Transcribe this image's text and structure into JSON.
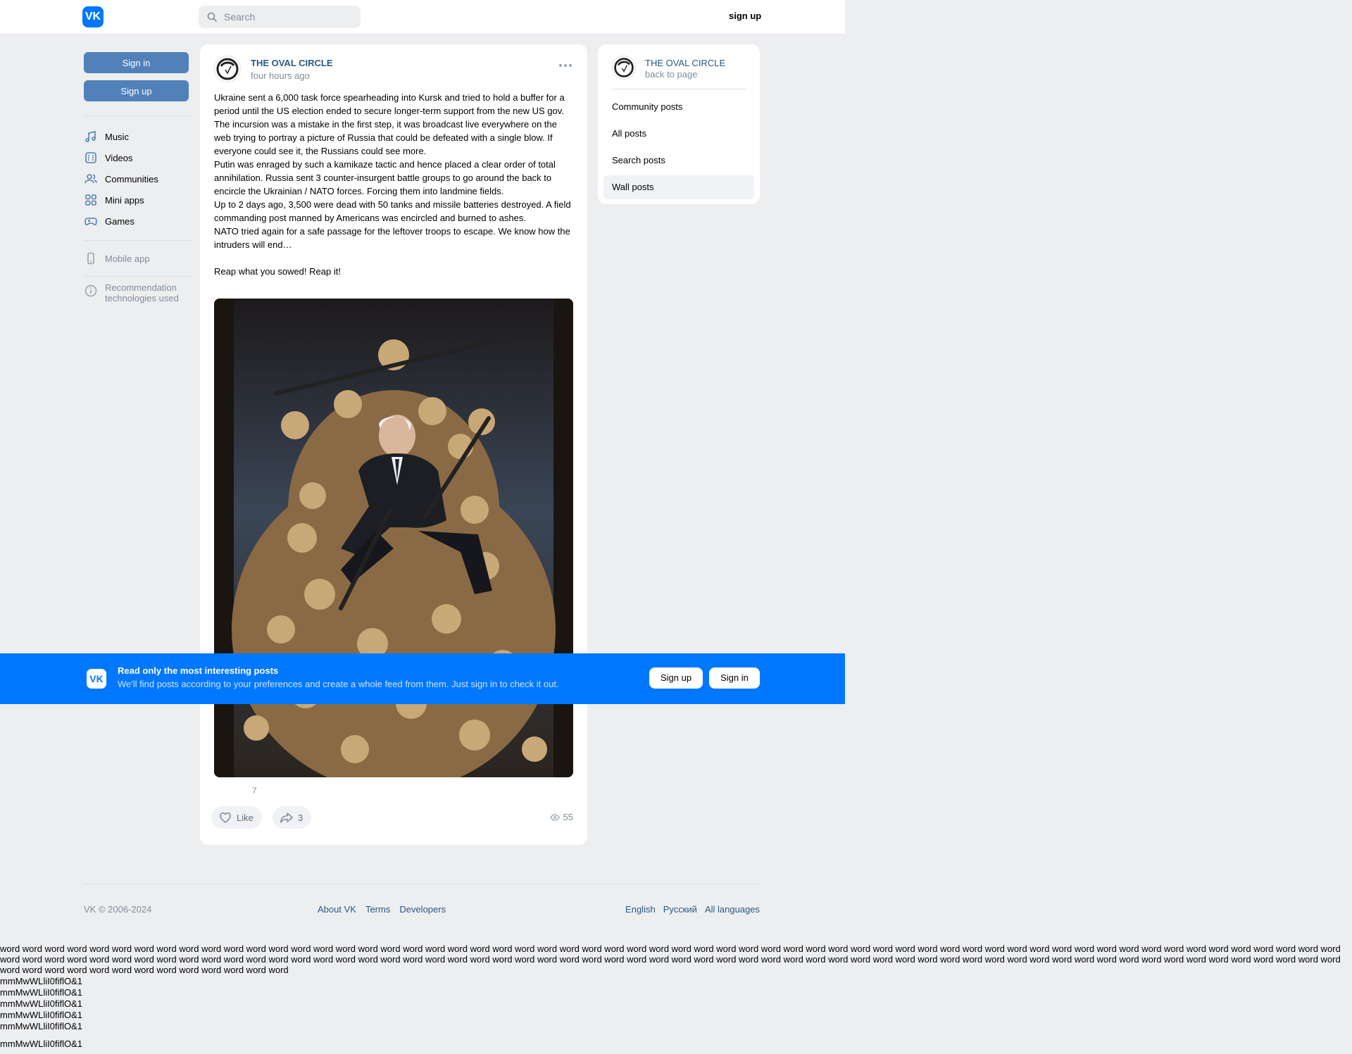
{
  "header": {
    "search_placeholder": "Search",
    "signup_label": "sign up"
  },
  "left": {
    "signin_label": "Sign in",
    "signup_label": "Sign up",
    "nav": {
      "music": "Music",
      "videos": "Videos",
      "communities": "Communities",
      "miniapps": "Mini apps",
      "games": "Games"
    },
    "mobile_app": "Mobile app",
    "recommendation": "Recommendation technologies used"
  },
  "post": {
    "author": "THE OVAL CIRCLE",
    "time": "four hours ago",
    "paragraphs": [
      "Ukraine sent a 6,000 task force spearheading into Kursk and tried to hold a buffer for a period until the US election ended to secure longer-term support from the new US gov.",
      "The incursion was a mistake in the first step, it was broadcast live everywhere on the web trying to portray a picture of Russia that could be defeated with a single blow. If everyone could see it, the Russians could see more.",
      "Putin was enraged by such a kamikaze tactic and hence placed a clear order of total annihilation. Russia sent 3 counter-insurgent battle groups to go around the back to encircle the Ukrainian / NATO forces. Forcing them into landmine fields.",
      "Up to 2 days ago, 3,500 were dead with 50 tanks and missile batteries destroyed. A field commanding post manned by Americans was encircled and burned to ashes.",
      "NATO tried again for a safe passage for the leftover troops to escape. We know how the intruders will end…",
      "Reap what you sowed! Reap it!"
    ],
    "reactions_count": "7",
    "like_label": "Like",
    "shares_count": "3",
    "views_count": "55"
  },
  "right": {
    "title": "THE OVAL CIRCLE",
    "subtitle": "back to page",
    "menu": [
      "Community posts",
      "All posts",
      "Search posts",
      "Wall posts"
    ]
  },
  "banner": {
    "title": "Read only the most interesting posts",
    "subtitle": "We'll find posts according to your preferences and create a whole feed from them. Just sign in to check it out.",
    "signup_label": "Sign up",
    "signin_label": "Sign in"
  },
  "footer": {
    "copyright": "VK © 2006-2024",
    "links": [
      "About VK",
      "Terms",
      "Developers"
    ],
    "languages": [
      "English",
      "Русский",
      "All languages"
    ]
  },
  "test": {
    "words": "word word word word word word word word word word word word word word word word word word word word word word word word word word word word word word word word word word word word word word word word word word word word word word word word word word word word word word word word word word word word word word word word word word word word word word word word word word word word word word word word word word word word word word word word word word word word word word word word word word word word word word word word word word word word word word word word word word word word word word word word word word word word word word word word word word word word word",
    "glyph_line": "mmMwWLliI0fiflO&1"
  },
  "colors": {
    "accent": "#0077ff",
    "button": "#5181b8",
    "link": "#2a5885",
    "background": "#edeef0"
  }
}
